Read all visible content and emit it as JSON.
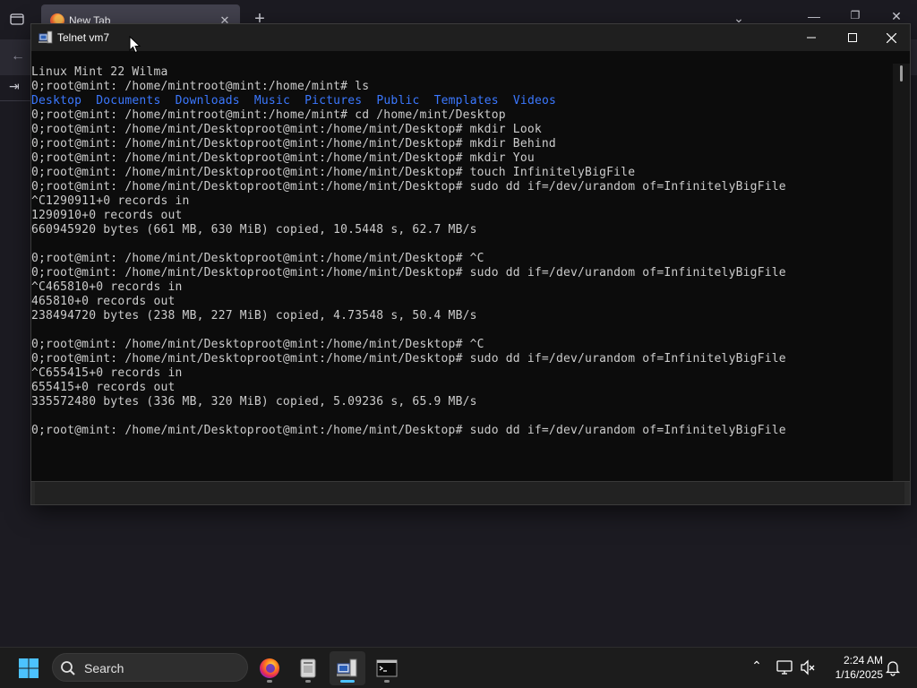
{
  "browser": {
    "tab_title": "New Tab",
    "tab_close_glyph": "✕",
    "new_tab_glyph": "+",
    "dropdown_glyph": "⌄",
    "min_glyph": "—",
    "max_glyph": "❐",
    "close_glyph": "✕",
    "back_glyph": "←",
    "side_glyph": "⇥"
  },
  "console": {
    "title": "Telnet vm7",
    "lines": [
      "Linux Mint 22 Wilma",
      "0;root@mint: /home/mintroot@mint:/home/mint# ls",
      "",
      "0;root@mint: /home/mintroot@mint:/home/mint# cd /home/mint/Desktop",
      "0;root@mint: /home/mint/Desktoproot@mint:/home/mint/Desktop# mkdir Look",
      "0;root@mint: /home/mint/Desktoproot@mint:/home/mint/Desktop# mkdir Behind",
      "0;root@mint: /home/mint/Desktoproot@mint:/home/mint/Desktop# mkdir You",
      "0;root@mint: /home/mint/Desktoproot@mint:/home/mint/Desktop# touch InfinitelyBigFile",
      "0;root@mint: /home/mint/Desktoproot@mint:/home/mint/Desktop# sudo dd if=/dev/urandom of=InfinitelyBigFile",
      "^C1290911+0 records in",
      "1290910+0 records out",
      "660945920 bytes (661 MB, 630 MiB) copied, 10.5448 s, 62.7 MB/s",
      "",
      "0;root@mint: /home/mint/Desktoproot@mint:/home/mint/Desktop# ^C",
      "0;root@mint: /home/mint/Desktoproot@mint:/home/mint/Desktop# sudo dd if=/dev/urandom of=InfinitelyBigFile",
      "^C465810+0 records in",
      "465810+0 records out",
      "238494720 bytes (238 MB, 227 MiB) copied, 4.73548 s, 50.4 MB/s",
      "",
      "0;root@mint: /home/mint/Desktoproot@mint:/home/mint/Desktop# ^C",
      "0;root@mint: /home/mint/Desktoproot@mint:/home/mint/Desktop# sudo dd if=/dev/urandom of=InfinitelyBigFile",
      "^C655415+0 records in",
      "655415+0 records out",
      "335572480 bytes (336 MB, 320 MiB) copied, 5.09236 s, 65.9 MB/s",
      "",
      "0;root@mint: /home/mint/Desktoproot@mint:/home/mint/Desktop# sudo dd if=/dev/urandom of=InfinitelyBigFile"
    ],
    "ls_items": [
      "Desktop",
      "Documents",
      "Downloads",
      "Music",
      "Pictures",
      "Public",
      "Templates",
      "Videos"
    ],
    "ls_color": "#3b78ff",
    "text_color": "#cccccc",
    "background": "#0c0c0c"
  },
  "taskbar": {
    "search_label": "Search",
    "time": "2:24 AM",
    "date": "1/16/2025",
    "tray_chevron": "⌃",
    "apps": [
      "firefox-icon",
      "file-manager-icon",
      "telnet-icon",
      "terminal-icon"
    ],
    "accent": "#4cc2ff"
  }
}
